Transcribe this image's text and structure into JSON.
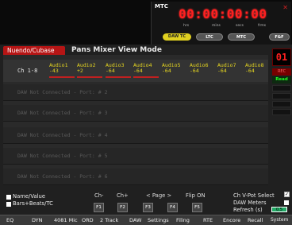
{
  "mtc": {
    "label": "MTC",
    "timecode": "00:00:00:00",
    "units": [
      "hrs",
      "mins",
      "secs",
      "frms"
    ],
    "sources": [
      "DAW TC",
      "LTC",
      "MTC"
    ],
    "ff_label": "F&F"
  },
  "header": {
    "tab": "Nuendo/Cubase",
    "title": "Pans Mixer View Mode"
  },
  "channels": {
    "range_label": "Ch 1-8",
    "items": [
      {
        "name": "Audio1",
        "value": "-43"
      },
      {
        "name": "Audio2",
        "value": "+2"
      },
      {
        "name": "Audio3",
        "value": "-64"
      },
      {
        "name": "Audio4",
        "value": "-64"
      },
      {
        "name": "Audio5",
        "value": "-64"
      },
      {
        "name": "Audio6",
        "value": "-64"
      },
      {
        "name": "Audio7",
        "value": "-64"
      },
      {
        "name": "Audio8",
        "value": "-64"
      }
    ]
  },
  "ports": [
    "DAW Not Connected - Port: # 2",
    "DAW Not Connected - Port: # 3",
    "DAW Not Connected - Port: # 4",
    "DAW Not Connected - Port: # 5",
    "DAW Not Connected - Port: # 6"
  ],
  "right_panel": {
    "channel_number": "01",
    "rec": "REC",
    "read": "Read"
  },
  "options": {
    "name_value": "Name/Value",
    "bars_beats": "Bars+Beats/TC",
    "ch_minus": "Ch-",
    "ch_plus": "Ch+",
    "page": "< Page >",
    "flip": "Flip ON",
    "vpot_select": "Ch V-Pot Select",
    "daw_meters": "DAW Meters",
    "refresh": "Refresh (s)",
    "refresh_value": "0.5",
    "vpot_checked": "✓"
  },
  "fkeys": [
    "F1",
    "F2",
    "F3",
    "F4",
    "F5"
  ],
  "menu": [
    "EQ",
    "DYN",
    "4081 Mic",
    "ORD",
    "2 Track",
    "DAW",
    "Settings",
    "Filing",
    "RTE",
    "Encore",
    "Recall",
    "System"
  ]
}
